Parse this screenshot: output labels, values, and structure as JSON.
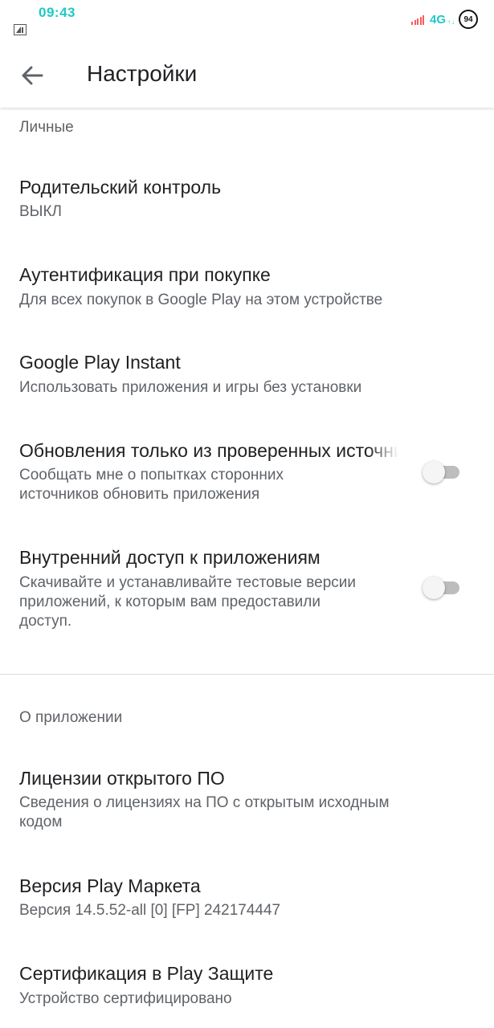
{
  "status_bar": {
    "time": "09:43",
    "network": "4G",
    "battery": "94",
    "icons": [
      "notification-icon",
      "signal-icon",
      "battery-icon"
    ],
    "colors": {
      "time": "#1fc9c4",
      "signal": "#ff5a5a"
    }
  },
  "app_bar": {
    "back_icon": "arrow-back-icon",
    "title": "Настройки"
  },
  "sections": {
    "personal": {
      "header": "Личные",
      "items": [
        {
          "title": "Родительский контроль",
          "summary": "ВЫКЛ"
        },
        {
          "title": "Аутентификация при покупке",
          "summary": "Для всех покупок в Google Play на этом устройстве"
        },
        {
          "title": "Google Play Instant",
          "summary": "Использовать приложения и игры без установки"
        },
        {
          "title": "Обновления только из проверенных источников",
          "summary": "Сообщать мне о попытках сторонних\nисточников обновить приложения",
          "toggle": false
        },
        {
          "title": "Внутренний доступ к приложениям",
          "summary": "Скачивайте и устанавливайте тестовые версии\nприложений, к которым вам предоставили\nдоступ.",
          "toggle": false
        }
      ]
    },
    "about": {
      "header": "О приложении",
      "items": [
        {
          "title": "Лицензии открытого ПО",
          "summary": "Сведения о лицензиях на ПО с открытым исходным\nкодом"
        },
        {
          "title": "Версия Play Маркета",
          "summary": "Версия 14.5.52-all [0] [FP] 242174447"
        },
        {
          "title": "Сертификация в Play Защите",
          "summary": "Устройство сертифицировано"
        }
      ]
    }
  }
}
